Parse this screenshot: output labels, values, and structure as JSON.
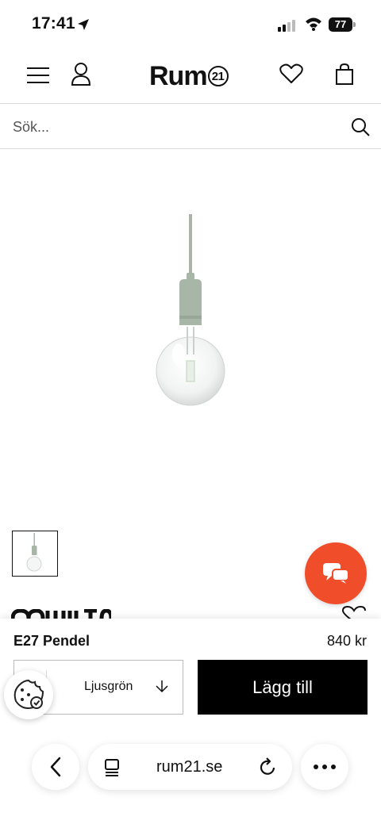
{
  "status_bar": {
    "time": "17:41",
    "battery": "77"
  },
  "header": {
    "logo_text": "Rum",
    "logo_badge": "21"
  },
  "search": {
    "placeholder": "Sök..."
  },
  "product": {
    "name": "E27 Pendel",
    "price": "840 kr",
    "variant": "Ljusgrön",
    "add_label": "Lägg till"
  },
  "browser": {
    "url": "rum21.se"
  },
  "colors": {
    "accent_chat": "#f04e2a",
    "button_bg": "#000000",
    "lamp_green": "#a7b6a7"
  }
}
